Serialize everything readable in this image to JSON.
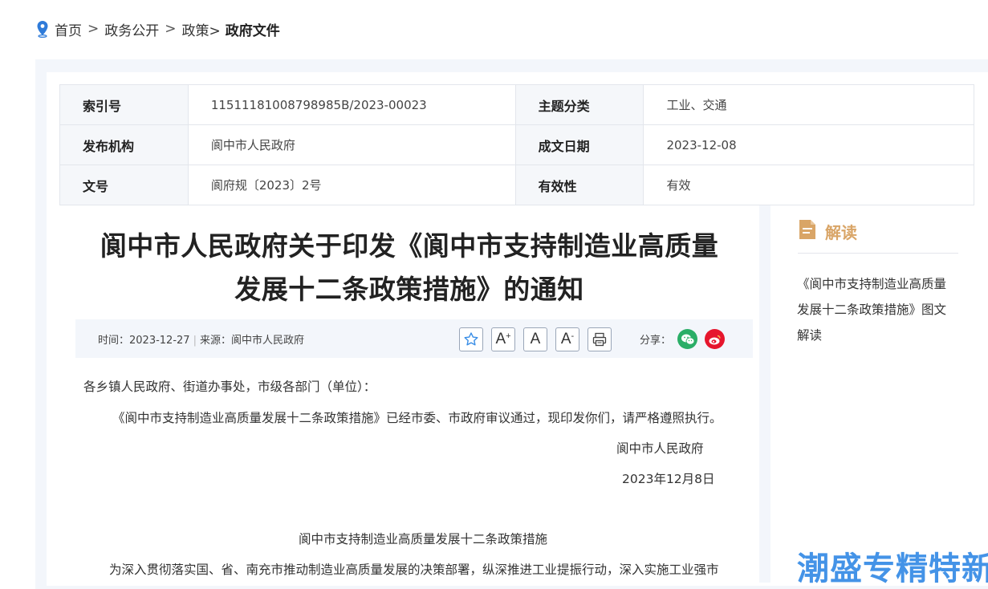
{
  "breadcrumb": {
    "home": "首页",
    "sep": ">",
    "gov_open": "政务公开",
    "policy": "政策>",
    "current": "政府文件"
  },
  "meta": {
    "index_label": "索引号",
    "index_value": "11511181008798985B/2023-00023",
    "topic_label": "主题分类",
    "topic_value": "工业、交通",
    "org_label": "发布机构",
    "org_value": "阆中市人民政府",
    "date_label": "成文日期",
    "date_value": "2023-12-08",
    "docno_label": "文号",
    "docno_value": "阆府规〔2023〕2号",
    "valid_label": "有效性",
    "valid_value": "有效"
  },
  "article": {
    "title_line1": "阆中市人民政府关于印发《阆中市支持制造业高质量",
    "title_line2": "发展十二条政策措施》的通知",
    "time": "时间：2023-12-27",
    "source": "来源：阆中市人民政府",
    "share_label": "分享：",
    "tool_a_large": "A",
    "tool_a_plus": "+",
    "tool_a": "A",
    "tool_a_small": "A",
    "tool_a_minus": "-",
    "salutation": "各乡镇人民政府、街道办事处，市级各部门（单位）：",
    "paragraph1": "《阆中市支持制造业高质量发展十二条政策措施》已经市委、市政府审议通过，现印发你们，请严格遵照执行。",
    "signature_org": "阆中市人民政府",
    "signature_date": "2023年12月8日",
    "subtitle": "阆中市支持制造业高质量发展十二条政策措施",
    "paragraph2": "为深入贯彻落实国、省、南充市推动制造业高质量发展的决策部署，纵深推进工业提振行动，深入实施工业强市"
  },
  "sidebar": {
    "heading": "解读",
    "link": "《阆中市支持制造业高质量发展十二条政策措施》图文解读"
  },
  "watermark": "潮盛专精特新",
  "colors": {
    "accent": "#d9a567",
    "link_blue": "#3a8ee6",
    "wechat": "#2aae67",
    "weibo": "#e6162d"
  }
}
